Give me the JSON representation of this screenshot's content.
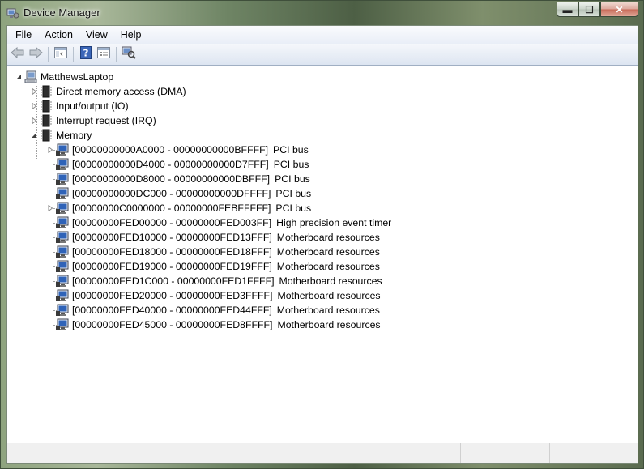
{
  "window": {
    "title": "Device Manager"
  },
  "caption_buttons": {
    "minimize": "▬",
    "maximize": "☐",
    "close": "✕"
  },
  "menu": [
    "File",
    "Action",
    "View",
    "Help"
  ],
  "toolbar": [
    "back-icon",
    "forward-icon",
    "show-hide-console-tree-icon",
    "help-icon",
    "properties-icon",
    "scan-hardware-icon"
  ],
  "tree": {
    "root": "MatthewsLaptop",
    "categories": [
      {
        "label": "Direct memory access (DMA)",
        "expanded": false
      },
      {
        "label": "Input/output (IO)",
        "expanded": false
      },
      {
        "label": "Interrupt request (IRQ)",
        "expanded": false
      },
      {
        "label": "Memory",
        "expanded": true
      }
    ],
    "memory_items": [
      {
        "range": "[00000000000A0000 - 00000000000BFFFF]",
        "device": "PCI bus",
        "expandable": true
      },
      {
        "range": "[00000000000D4000 - 00000000000D7FFF]",
        "device": "PCI bus",
        "expandable": false
      },
      {
        "range": "[00000000000D8000 - 00000000000DBFFF]",
        "device": "PCI bus",
        "expandable": false
      },
      {
        "range": "[00000000000DC000 - 00000000000DFFFF]",
        "device": "PCI bus",
        "expandable": false
      },
      {
        "range": "[00000000C0000000 - 00000000FEBFFFFF]",
        "device": "PCI bus",
        "expandable": true
      },
      {
        "range": "[00000000FED00000 - 00000000FED003FF]",
        "device": "High precision event timer",
        "expandable": false
      },
      {
        "range": "[00000000FED10000 - 00000000FED13FFF]",
        "device": "Motherboard resources",
        "expandable": false
      },
      {
        "range": "[00000000FED18000 - 00000000FED18FFF]",
        "device": "Motherboard resources",
        "expandable": false
      },
      {
        "range": "[00000000FED19000 - 00000000FED19FFF]",
        "device": "Motherboard resources",
        "expandable": false
      },
      {
        "range": "[00000000FED1C000 - 00000000FED1FFFF]",
        "device": "Motherboard resources",
        "expandable": false
      },
      {
        "range": "[00000000FED20000 - 00000000FED3FFFF]",
        "device": "Motherboard resources",
        "expandable": false
      },
      {
        "range": "[00000000FED40000 - 00000000FED44FFF]",
        "device": "Motherboard resources",
        "expandable": false
      },
      {
        "range": "[00000000FED45000 - 00000000FED8FFFF]",
        "device": "Motherboard resources",
        "expandable": false
      }
    ]
  },
  "status": [
    "",
    "",
    ""
  ]
}
